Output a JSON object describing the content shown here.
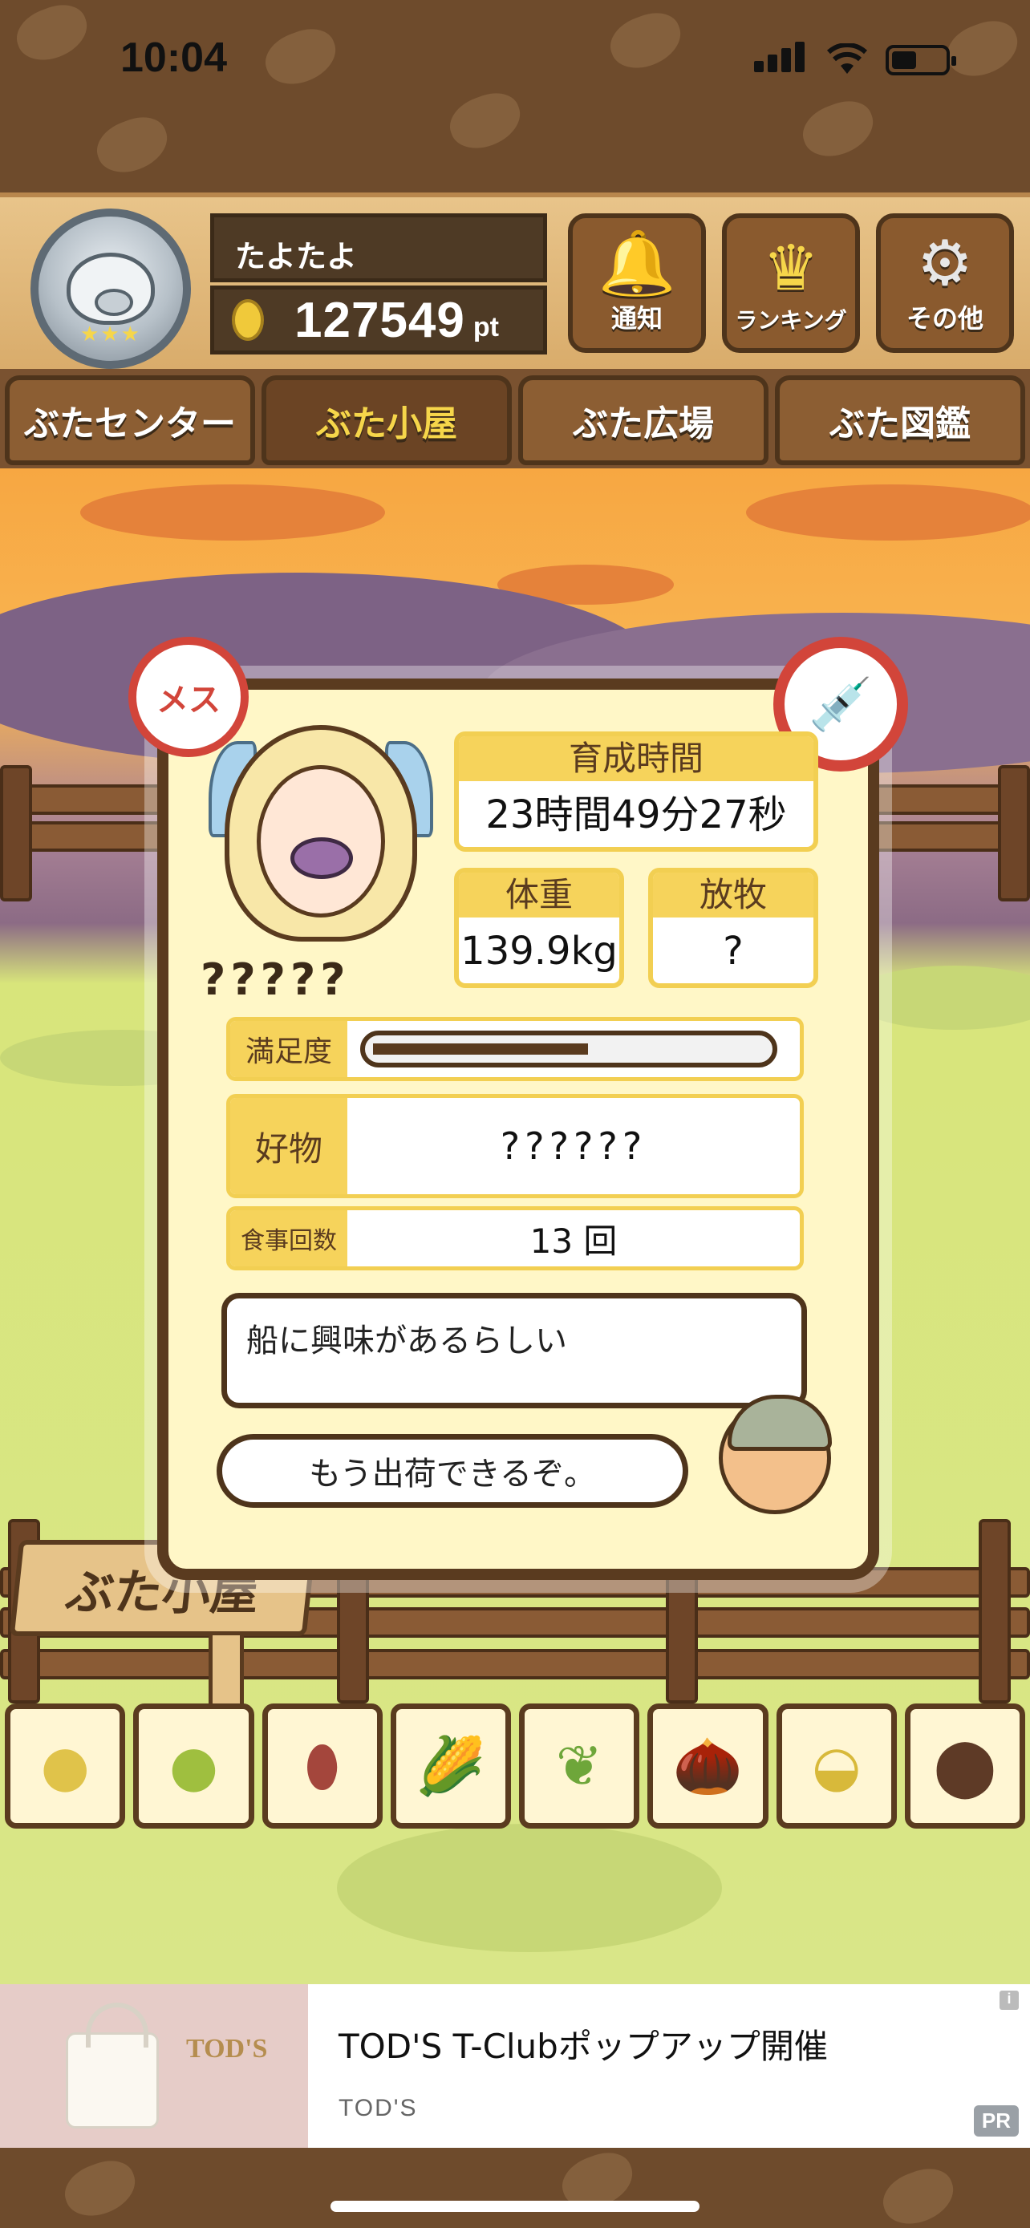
{
  "status_bar": {
    "time": "10:04"
  },
  "profile": {
    "name": "たよたよ",
    "points": "127549",
    "points_unit": "pt"
  },
  "header_buttons": [
    {
      "label": "通知",
      "icon": "bell-icon"
    },
    {
      "label": "ランキング",
      "icon": "crown-icon"
    },
    {
      "label": "その他",
      "icon": "gear-icon"
    }
  ],
  "tabs": [
    {
      "label": "ぶたセンター",
      "active": false
    },
    {
      "label": "ぶた小屋",
      "active": true
    },
    {
      "label": "ぶた広場",
      "active": false
    },
    {
      "label": "ぶた図鑑",
      "active": false
    }
  ],
  "pig": {
    "gender_badge": "メス",
    "name": "?????",
    "raising_time_label": "育成時間",
    "raising_time": "23時間49分27秒",
    "weight_label": "体重",
    "weight": "139.9kg",
    "grazing_label": "放牧",
    "grazing": "?",
    "satisfaction_label": "満足度",
    "satisfaction_fraction": 0.55,
    "favorite_label": "好物",
    "favorite": "??????",
    "meals_label": "食事回数",
    "meals": "13 回",
    "pig_comment": "船に興味があるらしい",
    "farmer_comment": "もう出荷できるぞ。"
  },
  "area_sign": "ぶた小屋",
  "food_items": [
    {
      "icon": "soybean-pile-icon"
    },
    {
      "icon": "mixed-beans-icon"
    },
    {
      "icon": "sweet-potato-icon"
    },
    {
      "icon": "corn-icon"
    },
    {
      "icon": "leaf-berries-icon"
    },
    {
      "icon": "acorn-icon"
    },
    {
      "icon": "grain-bowl-icon"
    },
    {
      "icon": "meatball-plate-icon"
    }
  ],
  "ad": {
    "title": "TOD'S T-Clubポップアップ開催",
    "sponsor": "TOD'S",
    "badge": "PR",
    "brand_logo": "TOD'S",
    "info": "i"
  },
  "colors": {
    "wood_dark": "#5a3b1f",
    "accent_yellow": "#f6d35b",
    "badge_red": "#d2453a",
    "card_bg": "#fff7c7"
  }
}
